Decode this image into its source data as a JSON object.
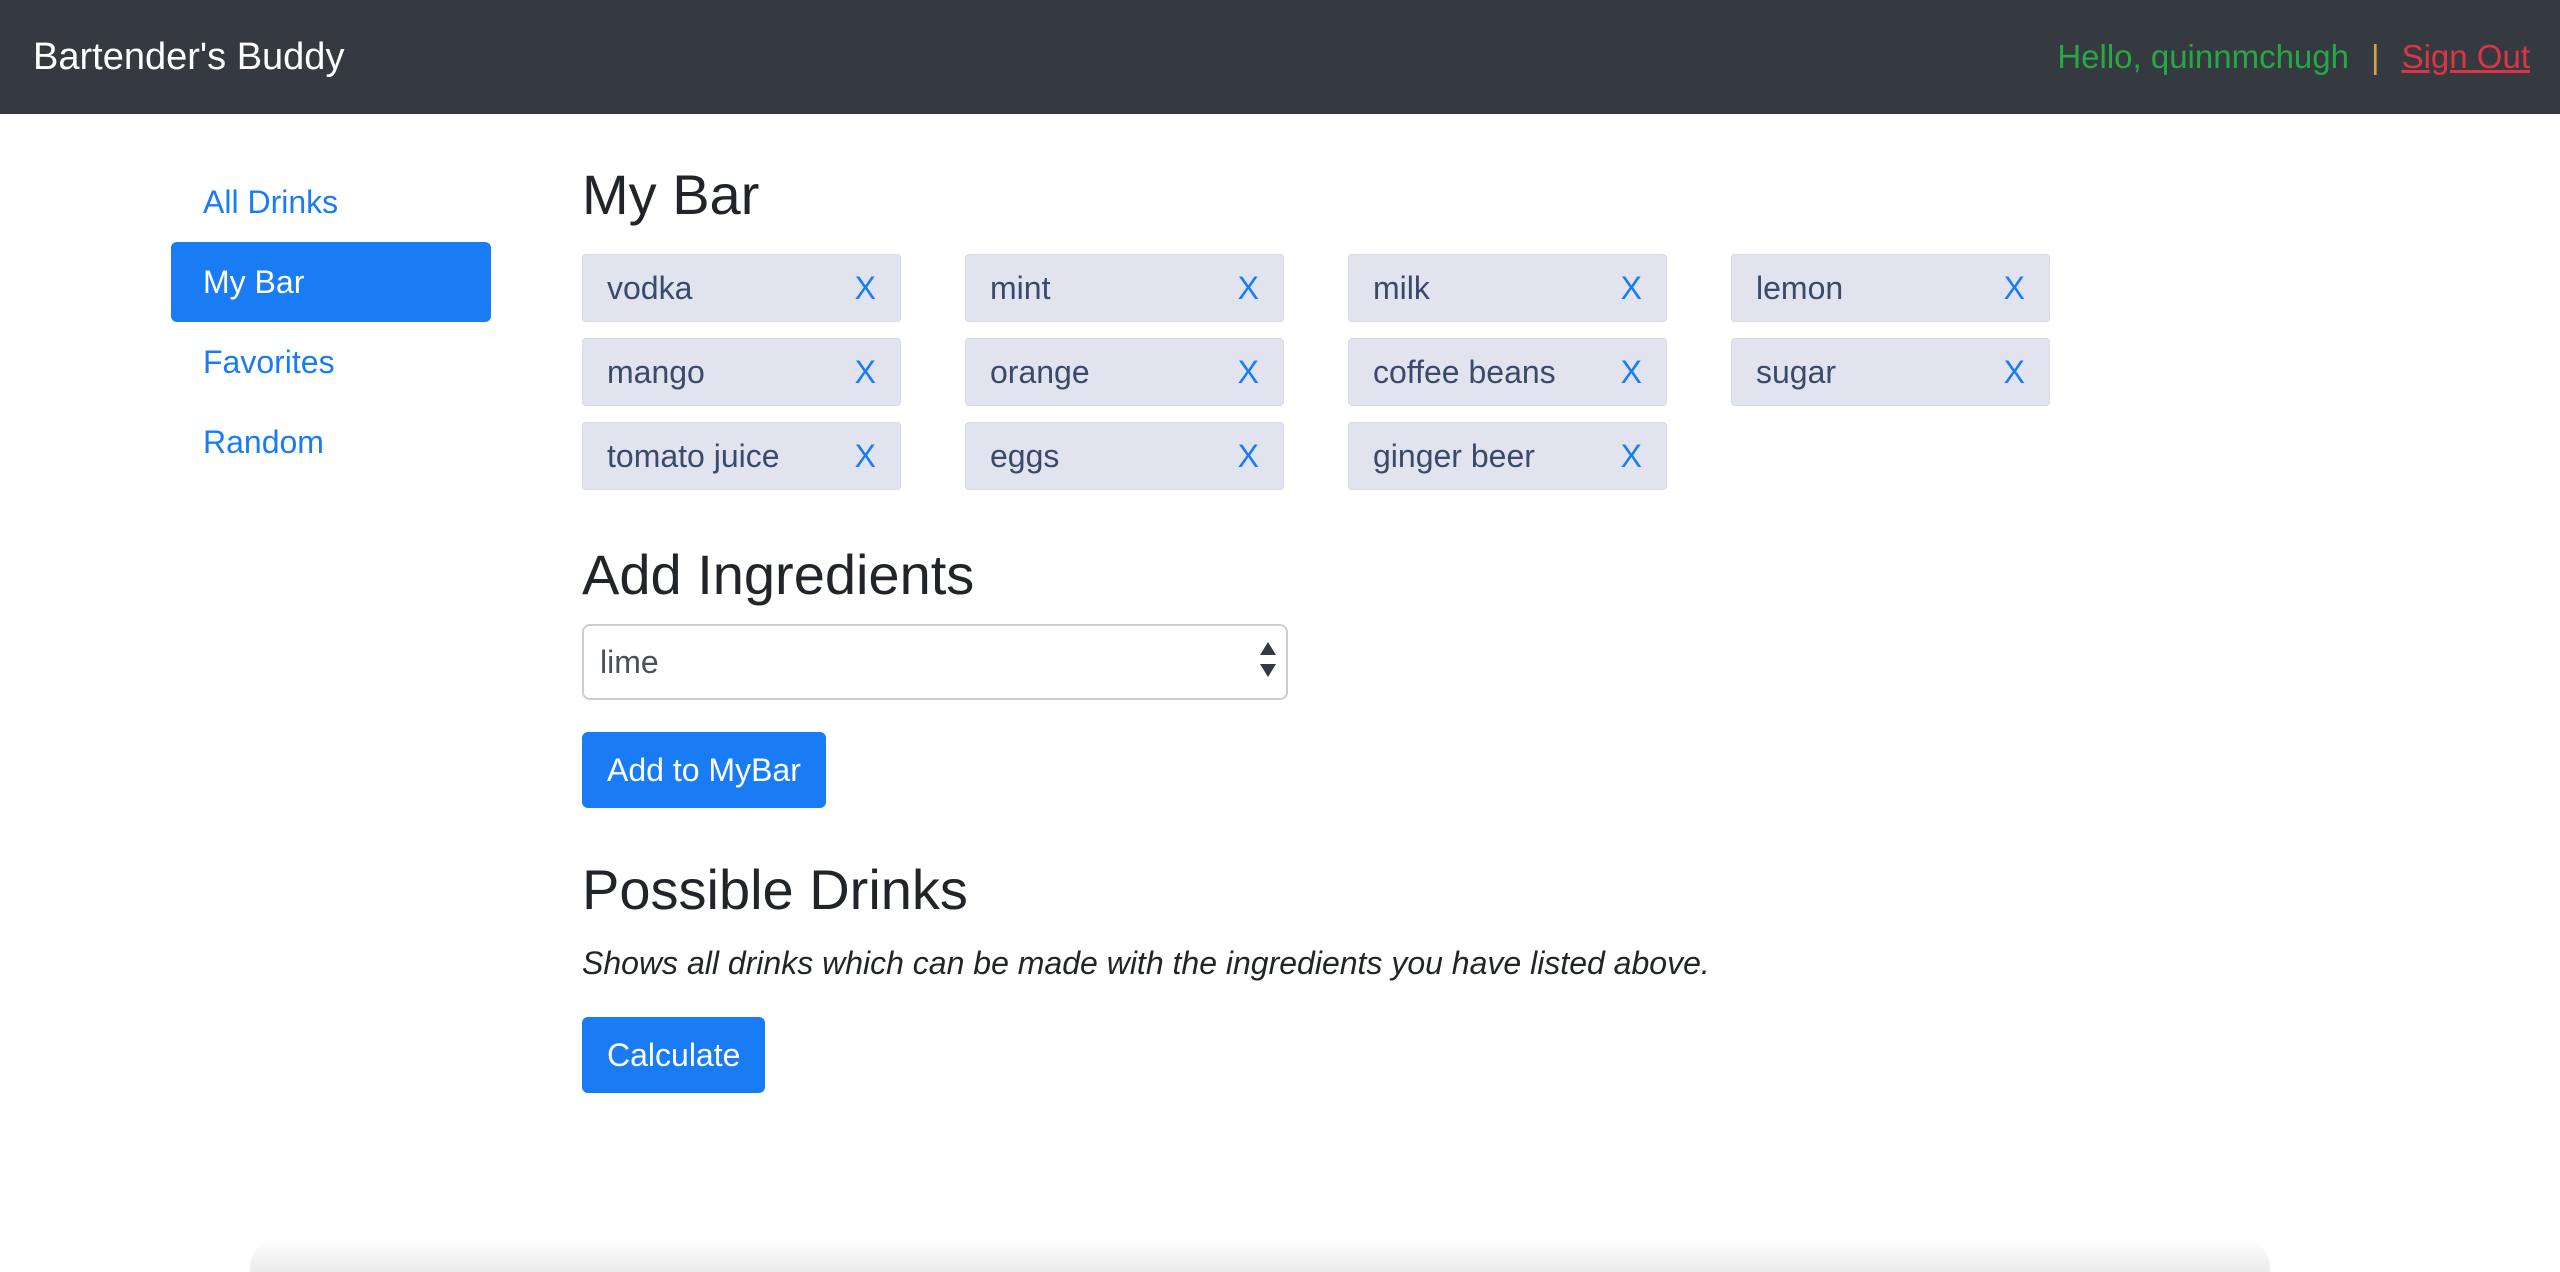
{
  "navbar": {
    "brand": "Bartender's Buddy",
    "greeting": "Hello, quinnmchugh",
    "separator": "|",
    "sign_out": "Sign Out"
  },
  "sidebar": {
    "items": [
      {
        "label": "All Drinks",
        "active": false
      },
      {
        "label": "My Bar",
        "active": true
      },
      {
        "label": "Favorites",
        "active": false
      },
      {
        "label": "Random",
        "active": false
      }
    ]
  },
  "my_bar": {
    "title": "My Bar",
    "remove_label": "X",
    "ingredients": [
      "vodka",
      "mint",
      "milk",
      "lemon",
      "mango",
      "orange",
      "coffee beans",
      "sugar",
      "tomato juice",
      "eggs",
      "ginger beer"
    ]
  },
  "add_ingredients": {
    "title": "Add Ingredients",
    "selected": "lime",
    "button": "Add to MyBar"
  },
  "possible_drinks": {
    "title": "Possible Drinks",
    "description": "Shows all drinks which can be made with the ingredients you have listed above.",
    "button": "Calculate"
  },
  "colors": {
    "navbar_bg": "#343a40",
    "primary": "#1a7cf5",
    "greeting": "#28a745",
    "sign_out": "#dc3545",
    "chip_bg": "#e1e4ee"
  }
}
